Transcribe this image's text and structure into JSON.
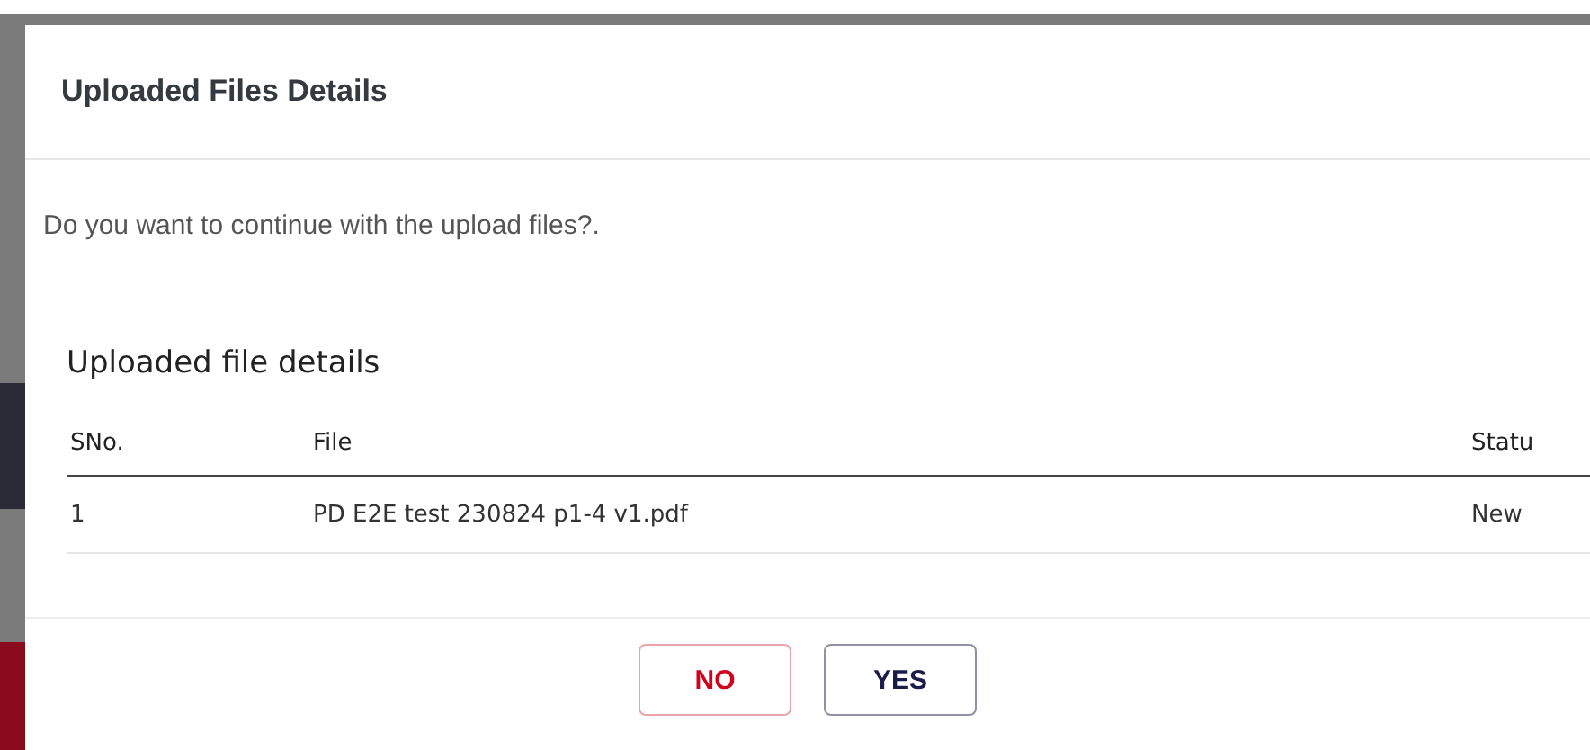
{
  "dialog": {
    "title": "Uploaded Files Details",
    "message": "Do you want to continue with the upload files?.",
    "section_title": "Uploaded file details",
    "table": {
      "columns": [
        "SNo.",
        "File",
        "Statu"
      ],
      "rows": [
        {
          "cells": [
            "1",
            "PD E2E test 230824 p1-4 v1.pdf",
            "New"
          ]
        }
      ]
    },
    "buttons": [
      {
        "label": "NO",
        "kind": "cancel"
      },
      {
        "label": "YES",
        "kind": "confirm"
      }
    ]
  }
}
